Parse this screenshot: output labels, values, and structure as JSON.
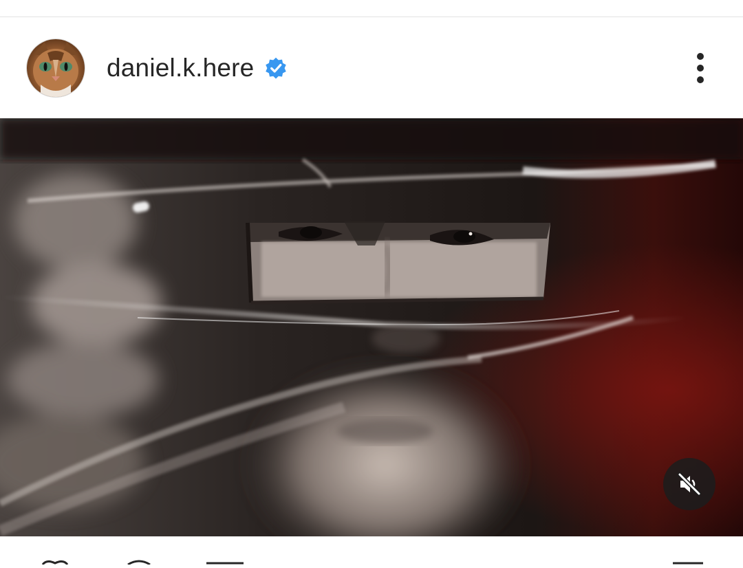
{
  "post": {
    "username": "daniel.k.here",
    "verified": true,
    "avatar_icon": "cat-avatar",
    "more_icon": "more-vertical-icon",
    "media": {
      "type": "video",
      "mute_icon": "speaker-muted-icon"
    }
  },
  "colors": {
    "verified_badge": "#3897f0",
    "text": "#262626",
    "divider": "#e2e2e2",
    "mute_button_bg": "#1c1c1c"
  }
}
